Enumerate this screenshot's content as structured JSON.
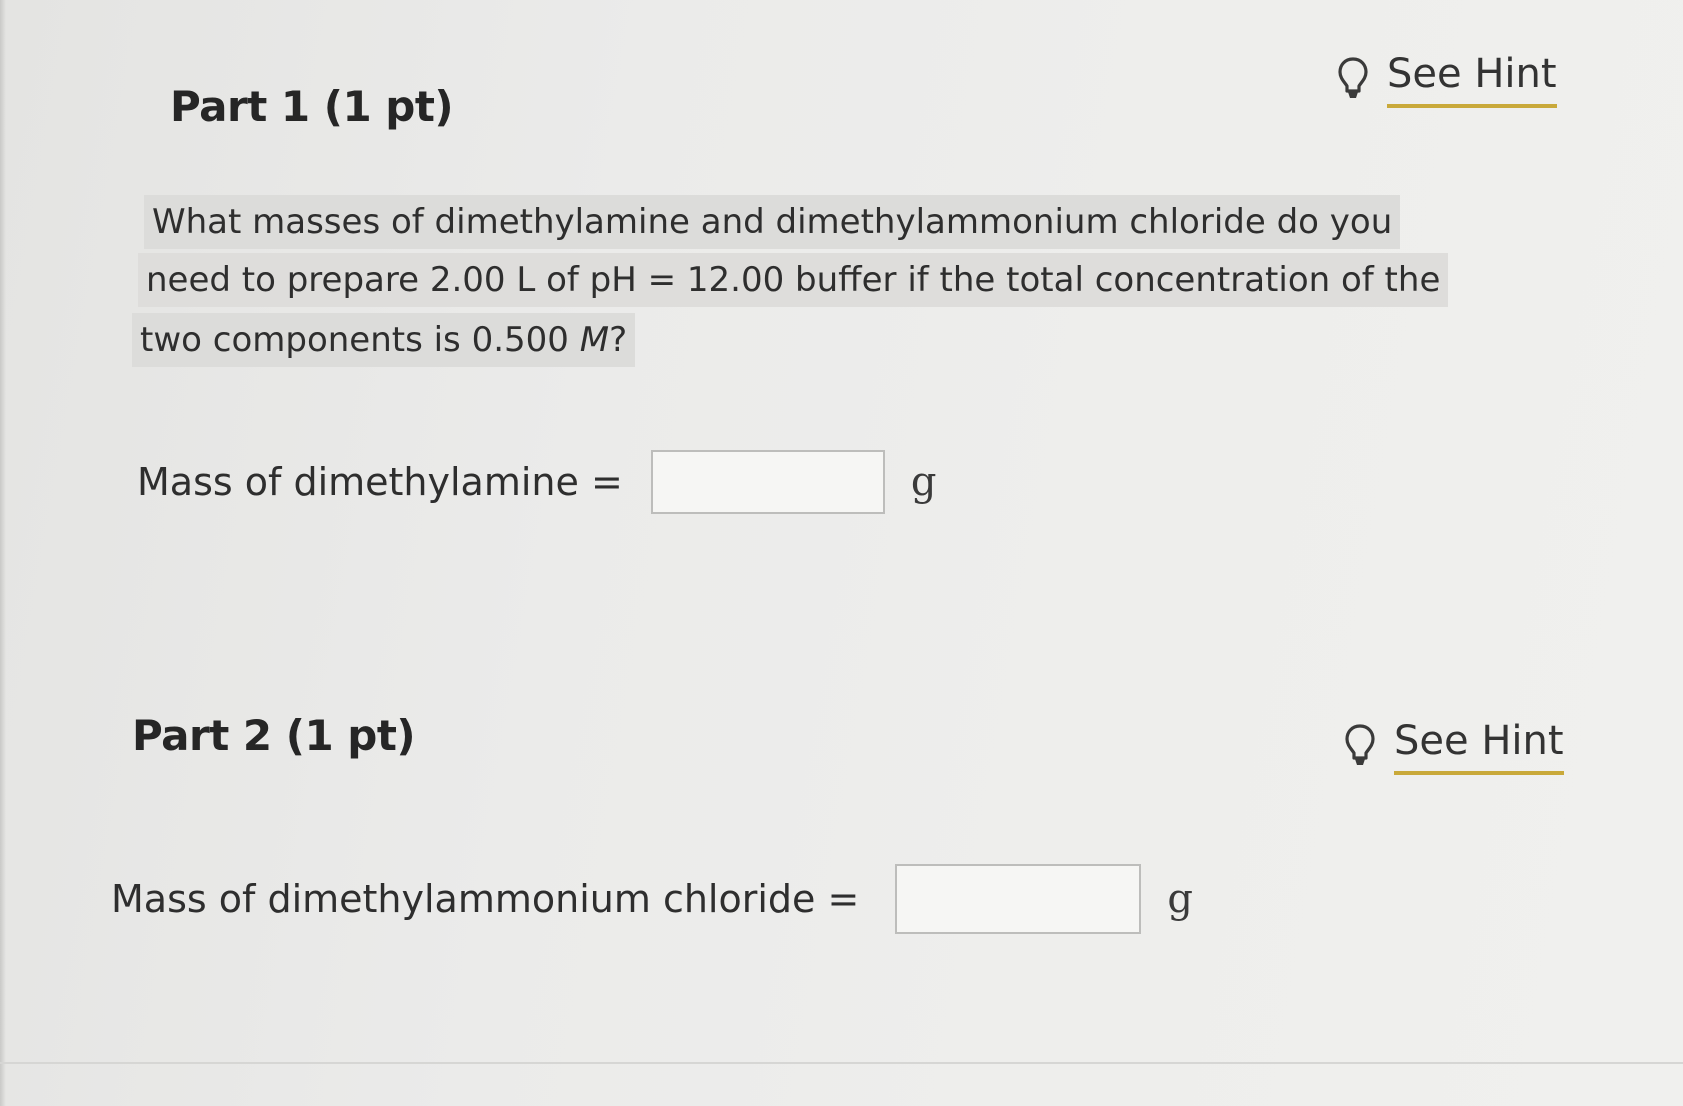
{
  "part1": {
    "title": "Part 1 (1 pt)",
    "hint_label": "See Hint",
    "question": {
      "line1": "What masses of dimethylamine and dimethylammonium chloride do you",
      "line2": "need to prepare 2.00 L of pH = 12.00 buffer if the total concentration of the",
      "line3_prefix": "two components is 0.500 ",
      "line3_var": "M",
      "line3_suffix": "?"
    },
    "answer": {
      "label": "Mass of dimethylamine =",
      "value": "",
      "unit": "g"
    }
  },
  "part2": {
    "title": "Part 2 (1 pt)",
    "hint_label": "See Hint",
    "answer": {
      "label": "Mass of dimethylammonium chloride =",
      "value": "",
      "unit": "g"
    }
  },
  "colors": {
    "hint_underline": "#c9a93a",
    "question_highlight": "#dcdcda"
  },
  "icons": {
    "hint": "lightbulb-icon"
  }
}
